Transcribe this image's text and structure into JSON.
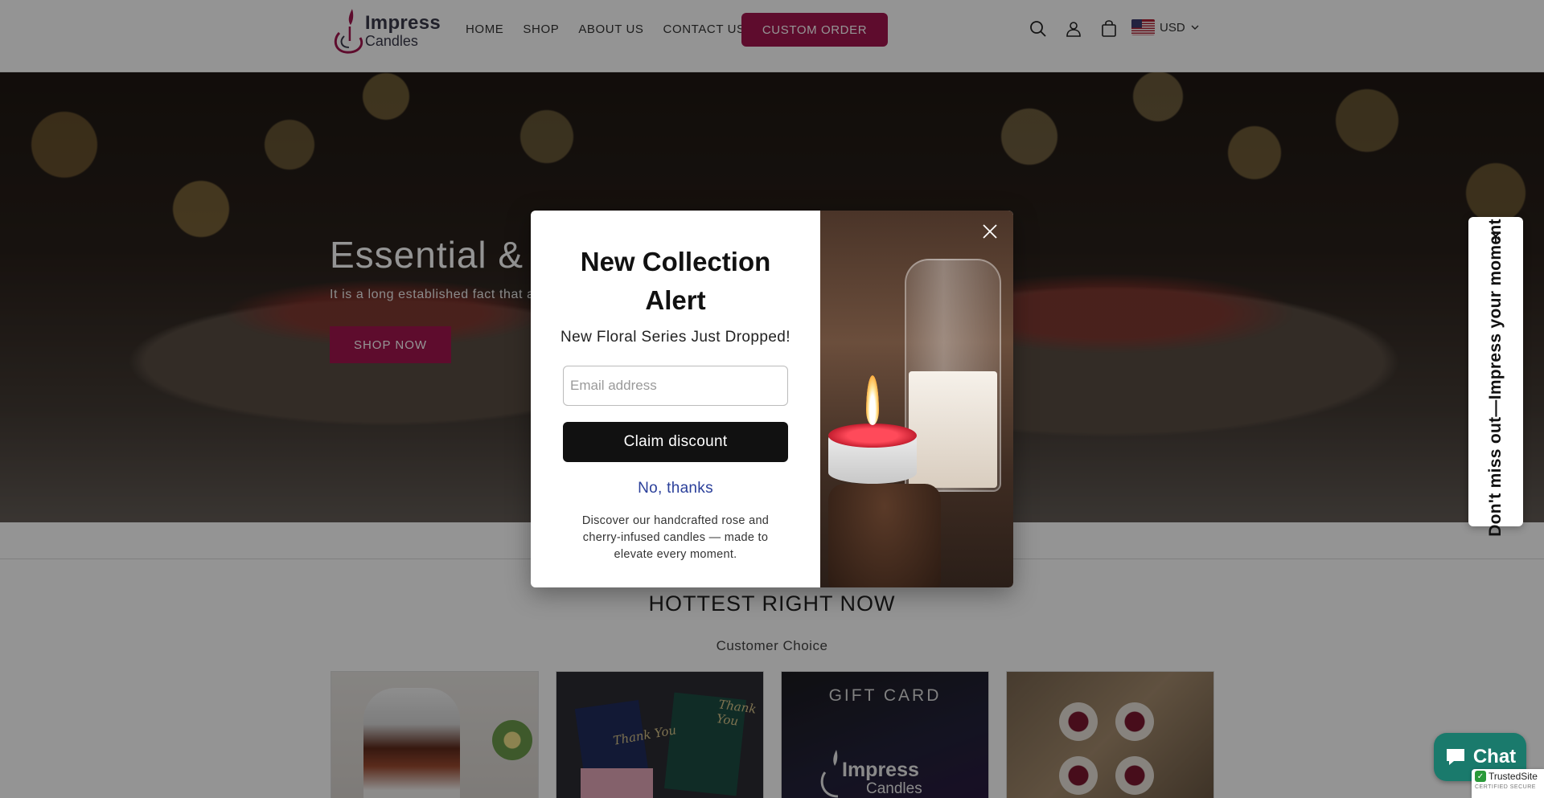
{
  "header": {
    "logo_line1": "Impress",
    "logo_line2": "Candles",
    "nav": [
      "HOME",
      "SHOP",
      "ABOUT US",
      "CONTACT US"
    ],
    "custom_order": "CUSTOM ORDER",
    "currency": "USD",
    "icons": [
      "search-icon",
      "account-icon",
      "cart-icon",
      "us-flag-icon",
      "chevron-down-icon"
    ],
    "accent_color": "#a3164f"
  },
  "hero": {
    "title": "Essential & M",
    "subtitle": "It is a long established fact that a",
    "button": "SHOP NOW"
  },
  "section": {
    "title": "HOTTEST RIGHT NOW",
    "subtitle": "Customer Choice",
    "cards": [
      {
        "name": "candle-glass-product"
      },
      {
        "name": "thank-you-gift-bags",
        "texts": [
          "Thank You",
          "Thank You"
        ]
      },
      {
        "name": "gift-card",
        "texts": [
          "GIFT CARD",
          "Impress",
          "Candles"
        ]
      },
      {
        "name": "rose-tealight-candles"
      }
    ]
  },
  "popup": {
    "title": "New Collection Alert",
    "subtitle": "New Floral Series Just Dropped!",
    "email_placeholder": "Email address",
    "email_value": "",
    "claim_button": "Claim discount",
    "no_thanks": "No, thanks",
    "description": "Discover our handcrafted rose and cherry-infused candles — made to elevate every moment."
  },
  "side_tab": {
    "text": "Don't miss out—Impress your moment"
  },
  "chat": {
    "label": "Chat"
  },
  "trusted": {
    "name": "TrustedSite",
    "sub": "CERTIFIED SECURE"
  }
}
